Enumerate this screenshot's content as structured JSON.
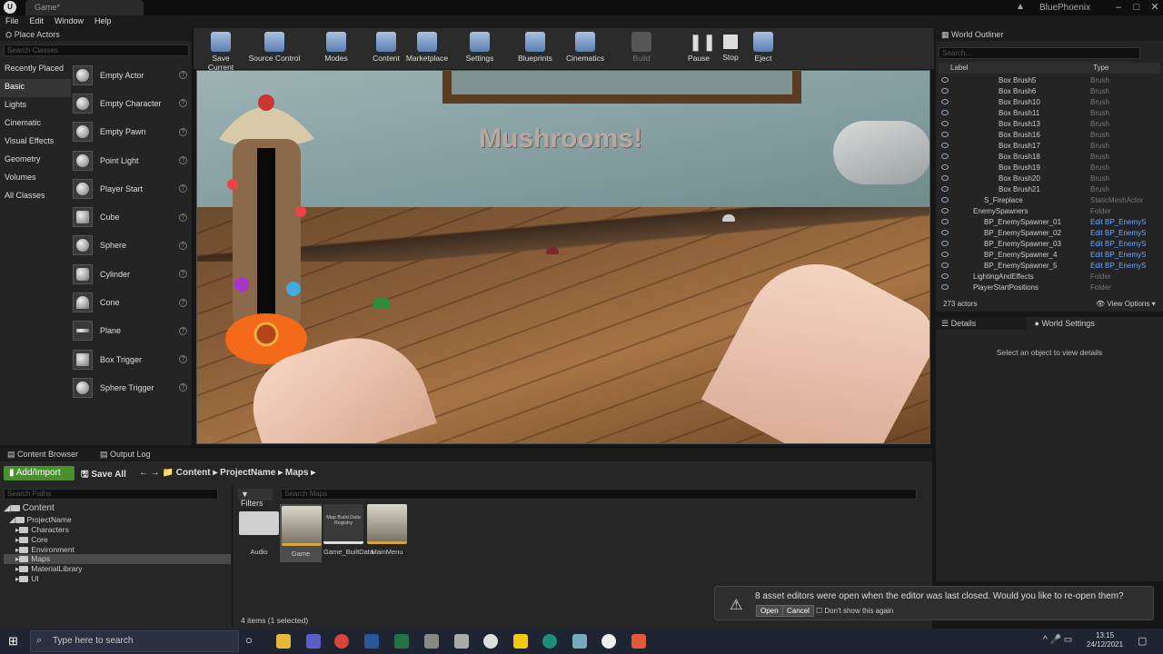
{
  "window": {
    "doc_tab": "Game*",
    "user": "BluePhoenix",
    "menu": [
      "File",
      "Edit",
      "Window",
      "Help"
    ]
  },
  "place_actors": {
    "tab": "Place Actors",
    "search_placeholder": "Search Classes",
    "categories": [
      "Recently Placed",
      "Basic",
      "Lights",
      "Cinematic",
      "Visual Effects",
      "Geometry",
      "Volumes",
      "All Classes"
    ],
    "items": [
      "Empty Actor",
      "Empty Character",
      "Empty Pawn",
      "Point Light",
      "Player Start",
      "Cube",
      "Sphere",
      "Cylinder",
      "Cone",
      "Plane",
      "Box Trigger",
      "Sphere Trigger"
    ]
  },
  "toolbar": [
    "Save Current",
    "Source Control",
    "Modes",
    "Content",
    "Marketplace",
    "Settings",
    "Blueprints",
    "Cinematics",
    "Build",
    "Pause",
    "Stop",
    "Eject"
  ],
  "viewport": {
    "hud_text": "Mushrooms!"
  },
  "outliner": {
    "tab": "World Outliner",
    "search_placeholder": "Search...",
    "col_label": "Label",
    "col_type": "Type",
    "rows": [
      {
        "label": "Box Brush5",
        "type": "Brush"
      },
      {
        "label": "Box Brush6",
        "type": "Brush"
      },
      {
        "label": "Box Brush10",
        "type": "Brush"
      },
      {
        "label": "Box Brush11",
        "type": "Brush"
      },
      {
        "label": "Box Brush13",
        "type": "Brush"
      },
      {
        "label": "Box Brush16",
        "type": "Brush"
      },
      {
        "label": "Box Brush17",
        "type": "Brush"
      },
      {
        "label": "Box Brush18",
        "type": "Brush"
      },
      {
        "label": "Box Brush19",
        "type": "Brush"
      },
      {
        "label": "Box Brush20",
        "type": "Brush"
      },
      {
        "label": "Box Brush21",
        "type": "Brush"
      },
      {
        "label": "S_Fireplace",
        "type": "StaticMeshActor"
      },
      {
        "label": "EnemySpawners",
        "type": "Folder"
      },
      {
        "label": "BP_EnemySpawner_01",
        "type": "Edit BP_EnemyS"
      },
      {
        "label": "BP_EnemySpawner_02",
        "type": "Edit BP_EnemyS"
      },
      {
        "label": "BP_EnemySpawner_03",
        "type": "Edit BP_EnemyS"
      },
      {
        "label": "BP_EnemySpawner_4",
        "type": "Edit BP_EnemyS"
      },
      {
        "label": "BP_EnemySpawner_5",
        "type": "Edit BP_EnemyS"
      },
      {
        "label": "LightingAndEffects",
        "type": "Folder"
      },
      {
        "label": "PlayerStartPositions",
        "type": "Folder"
      }
    ],
    "count": "273 actors",
    "view_options": "View Options"
  },
  "details": {
    "tab_details": "Details",
    "tab_world": "World Settings",
    "empty": "Select an object to view details"
  },
  "content_browser": {
    "tab": "Content Browser",
    "tab_log": "Output Log",
    "add_import": "Add/Import",
    "save_all": "Save All",
    "crumbs": [
      "Content",
      "ProjectName",
      "Maps"
    ],
    "path_search": "Search Paths",
    "filters": "Filters",
    "asset_search": "Search Maps",
    "tree": [
      "Content",
      "ProjectName",
      "Characters",
      "Core",
      "Environment",
      "Maps",
      "MaterialLibrary",
      "UI"
    ],
    "assets": [
      {
        "name": "Audio"
      },
      {
        "name": "Game"
      },
      {
        "name": "Game_BuiltData",
        "thumb_text": "Map Build Data Registry"
      },
      {
        "name": "MainMenu"
      }
    ],
    "count": "4 items (1 selected)"
  },
  "notification": {
    "text": "8 asset editors were open when the editor was last closed. Would you like to re-open them?",
    "open": "Open",
    "cancel": "Cancel",
    "dont_show": "Don't show this again"
  },
  "taskbar": {
    "search": "Type here to search",
    "time": "13:15",
    "date": "24/12/2021"
  }
}
